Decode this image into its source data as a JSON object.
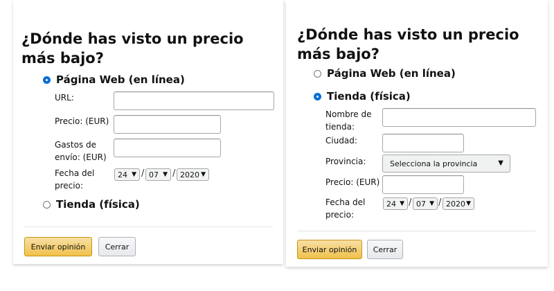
{
  "left": {
    "title": "¿Dónde has visto un precio más bajo?",
    "option_web": "Página Web (en línea)",
    "option_store": "Tienda (física)",
    "url_label": "URL:",
    "price_label": "Precio: (EUR)",
    "shipping_label_1": "Gastos de",
    "shipping_label_2": "envío: (EUR)",
    "date_label_1": "Fecha del",
    "date_label_2": "precio:",
    "day": "24",
    "month": "07",
    "year": "2020",
    "submit": "Enviar opinión",
    "close": "Cerrar"
  },
  "right": {
    "title": "¿Dónde has visto un precio más bajo?",
    "option_web": "Página Web (en línea)",
    "option_store": "Tienda (física)",
    "store_name_label_1": "Nombre de",
    "store_name_label_2": "tienda:",
    "city_label": "Ciudad:",
    "province_label": "Provincia:",
    "province_value": "Selecciona la provincia",
    "price_label": "Precio: (EUR)",
    "date_label_1": "Fecha del",
    "date_label_2": "precio:",
    "day": "24",
    "month": "07",
    "year": "2020",
    "submit": "Enviar opinión",
    "close": "Cerrar"
  },
  "icons": {
    "dropdown": "chevron-down-icon",
    "selected_radio": "radio-selected",
    "empty_radio": "radio-empty"
  },
  "colors": {
    "primary_button": "#f0c14b",
    "radio_selected": "#0a6fd6"
  }
}
